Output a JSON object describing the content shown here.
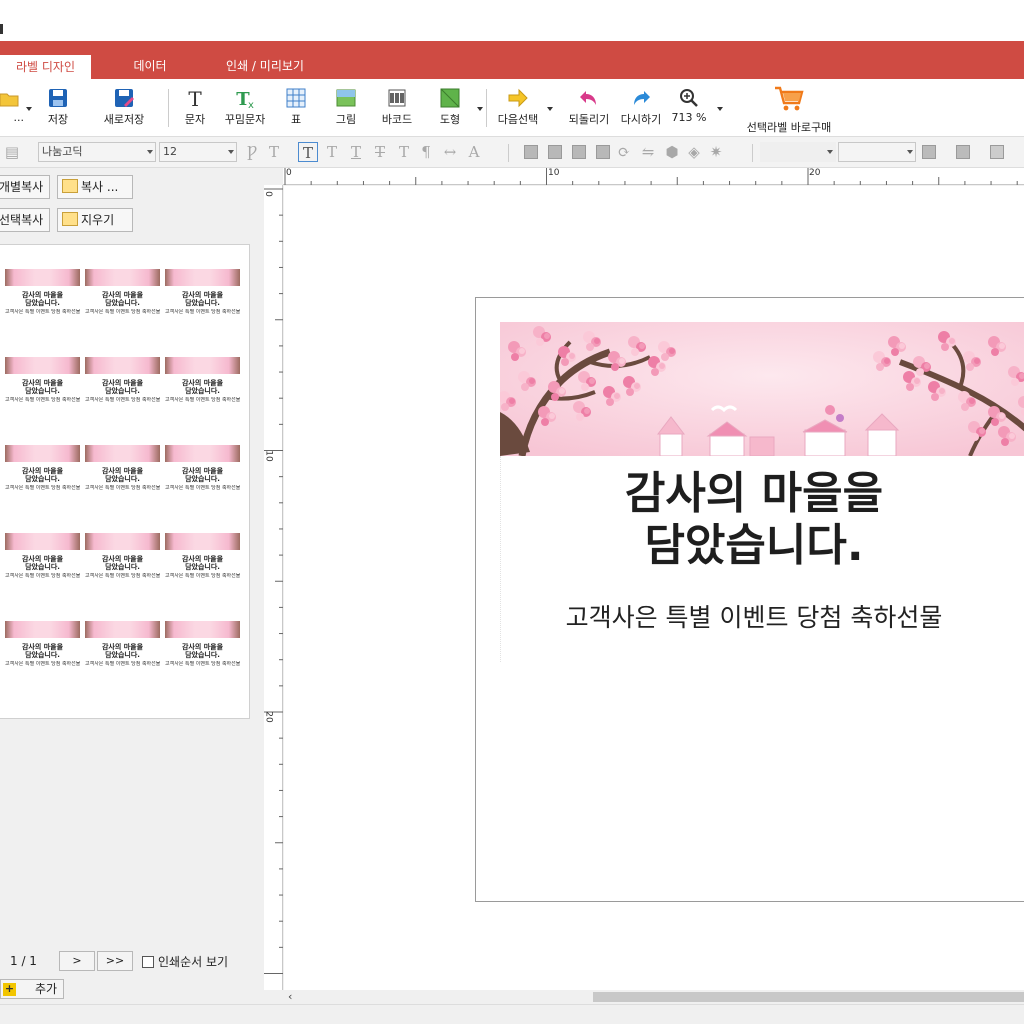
{
  "window": {
    "title": ""
  },
  "tabs": [
    {
      "label": "라벨 디자인",
      "active": true
    },
    {
      "label": "데이터",
      "active": false
    },
    {
      "label": "인쇄 / 미리보기",
      "active": false
    }
  ],
  "ribbon": {
    "open_label": "...",
    "save_label": "저장",
    "save_as_label": "새로저장",
    "text_label": "문자",
    "fancy_text_label": "꾸밈문자",
    "table_label": "표",
    "image_label": "그림",
    "barcode_label": "바코드",
    "shape_label": "도형",
    "next_select_label": "다음선택",
    "undo_label": "되돌리기",
    "redo_label": "다시하기",
    "zoom_label": "713 %",
    "buy_label": "선택라벨 바로구매"
  },
  "format": {
    "font_name": "나눔고딕",
    "font_size": "12"
  },
  "left_panel": {
    "copy_each_label": "개별복사",
    "copy_label": "복사 ...",
    "copy_selected_label": "선택복사",
    "erase_label": "지우기",
    "page_indicator": "1 / 1",
    "next_label": ">",
    "last_label": ">>",
    "print_order_label": "인쇄순서 보기",
    "add_label": "추가"
  },
  "rulers": {
    "h_ticks": [
      "0",
      "10",
      "20"
    ],
    "v_ticks": [
      "0",
      "10",
      "20"
    ]
  },
  "label": {
    "headline_line1": "감사의 마을을",
    "headline_line2": "담았습니다.",
    "subline": "고객사은 특별 이벤트 당첨 축하선물"
  },
  "thumbnails": {
    "rows": 5,
    "cols": 3,
    "line1": "감사의 마을을",
    "line2": "담았습니다.",
    "line3": "고객사은 특별 이벤트 당첨 축하선물"
  },
  "colors": {
    "accent": "#cf4b43",
    "banner_pink": "#fbdde6",
    "blossom": "#f39ab8",
    "branch": "#6a4a3e"
  }
}
